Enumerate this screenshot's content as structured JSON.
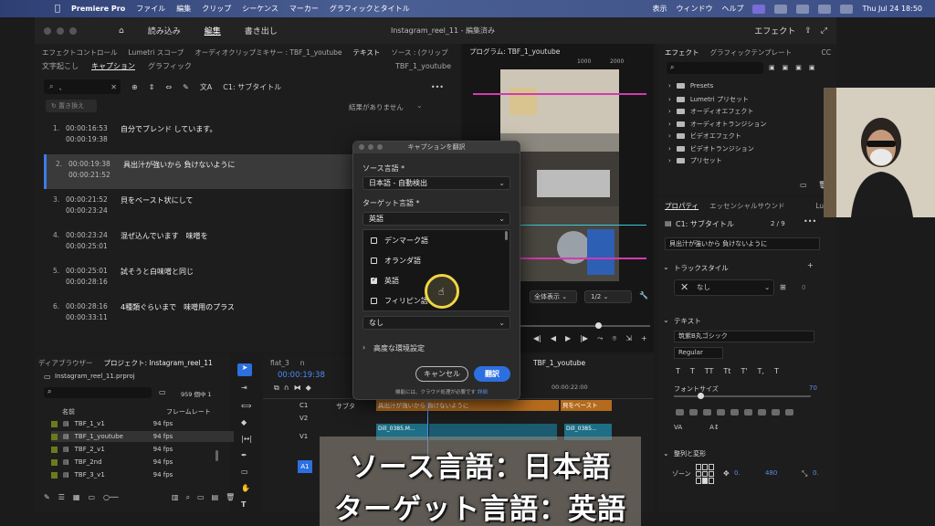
{
  "menubar": {
    "app": "Premiere Pro",
    "items": [
      "ファイル",
      "編集",
      "クリップ",
      "シーケンス",
      "マーカー",
      "グラフィックとタイトル"
    ],
    "right_items": [
      "表示",
      "ウィンドウ",
      "ヘルプ"
    ],
    "clock": "Thu Jul 24  18:50"
  },
  "titlebar": {
    "workspaces": [
      "読み込み",
      "編集",
      "書き出し"
    ],
    "document": "Instagram_reel_11 - 編集済み",
    "right_label": "エフェクト"
  },
  "left_panel": {
    "tabs": [
      "エフェクトコントロール",
      "Lumetri スコープ",
      "オーディオクリップミキサー : TBF_1_youtube",
      "テキスト",
      "ソース : (クリップ"
    ],
    "subtabs": [
      "文字起こし",
      "キャプション",
      "グラフィック"
    ],
    "sequence": "TBF_1_youtube",
    "search_value": "、",
    "track_label": "C1: サブタイトル",
    "replace_label": "置き換え",
    "no_results": "結果がありません",
    "captions": [
      {
        "num": "1.",
        "in": "00:00:16:53",
        "out": "00:00:19:38",
        "text": "自分でブレンド しています。"
      },
      {
        "num": "2.",
        "in": "00:00:19:38",
        "out": "00:00:21:52",
        "text": "具出汁が強いから 負けないように"
      },
      {
        "num": "3.",
        "in": "00:00:21:52",
        "out": "00:00:23:24",
        "text": "貝をベースト状にして"
      },
      {
        "num": "4.",
        "in": "00:00:23:24",
        "out": "00:00:25:01",
        "text": "混ぜ込んでいます　味噌を"
      },
      {
        "num": "5.",
        "in": "00:00:25:01",
        "out": "00:00:28:16",
        "text": "試そうと白味噌と同じ"
      },
      {
        "num": "6.",
        "in": "00:00:28:16",
        "out": "00:00:33:11",
        "text": "4種類ぐらいまで　味噌用のプラス"
      }
    ]
  },
  "program": {
    "title": "プログラム: TBF_1_youtube",
    "ruler": [
      "1000",
      "2000"
    ],
    "view": "全体表示",
    "quality": "1/2"
  },
  "effects": {
    "tabs": [
      "エフェクト",
      "グラフィックテンプレート",
      "CC"
    ],
    "items": [
      "Presets",
      "Lumetri プリセット",
      "オーディオエフェクト",
      "オーディオトランジション",
      "ビデオエフェクト",
      "ビデオトランジション",
      "プリセット"
    ]
  },
  "properties": {
    "tabs": [
      "プロパティ",
      "エッセンシャルサウンド",
      "Lume"
    ],
    "track": "C1: サブタイトル",
    "counter": "2 / 9",
    "caption_text": "貝出汁が強いから 負けないように",
    "track_style_label": "トラックスタイル",
    "track_style_value": "なし",
    "track_style_count": "0",
    "text_section": "テキスト",
    "font": "筑紫B丸ゴシック",
    "weight": "Regular",
    "font_size_label": "フォントサイズ",
    "font_size": "70",
    "align_section": "整列と変形",
    "zone_label": "ゾーン",
    "zone_x": "0.",
    "zone_y": "480",
    "zone_z": "0."
  },
  "project": {
    "tabs": [
      "ディアブラウザー",
      "プロジェクト: Instagram_reel_11"
    ],
    "file": "Instagram_reel_11.prproj",
    "count": "959 個中 1",
    "col_name": "名前",
    "col_rate": "フレームレート",
    "rows": [
      {
        "name": "TBF_1_v1",
        "rate": "94 fps"
      },
      {
        "name": "TBF_1_youtube",
        "rate": "94 fps"
      },
      {
        "name": "TBF_2_v1",
        "rate": "94 fps"
      },
      {
        "name": "TBF_2nd",
        "rate": "94 fps"
      },
      {
        "name": "TBF_3_v1",
        "rate": "94 fps"
      }
    ]
  },
  "timeline": {
    "tabs": [
      "flat_3",
      "n",
      "TBF_1_youtube"
    ],
    "timecode": "00:00:19:38",
    "ruler_time": "00:00:22:00",
    "tracks": [
      "C1",
      "V2",
      "V1",
      "A1"
    ],
    "c1_label": "サブタ",
    "clip_caption_1": "具出汁が強いから 負けないように",
    "clip_caption_2": "貝をベースト",
    "clip_v1a": "Dill_0385.M...",
    "clip_v1b": "Dill_0385..."
  },
  "dialog": {
    "title": "キャプションを翻訳",
    "source_label": "ソース言語 *",
    "source_value": "日本語 - 自動検出",
    "target_label": "ターゲット言語 *",
    "target_value": "英語",
    "languages": [
      {
        "name": "デンマーク語",
        "checked": false
      },
      {
        "name": "オランダ語",
        "checked": false
      },
      {
        "name": "英語",
        "checked": true
      },
      {
        "name": "フィリピン語",
        "checked": false
      }
    ],
    "style_value": "なし",
    "advanced": "高度な環境設定",
    "cancel": "キャンセル",
    "translate": "翻訳",
    "note": "機能には、クラウド処理が必要です",
    "note_link": "詳細"
  },
  "overlay": {
    "line1": "ソース言語：日本語",
    "line2": "ターゲット言語：英語"
  }
}
